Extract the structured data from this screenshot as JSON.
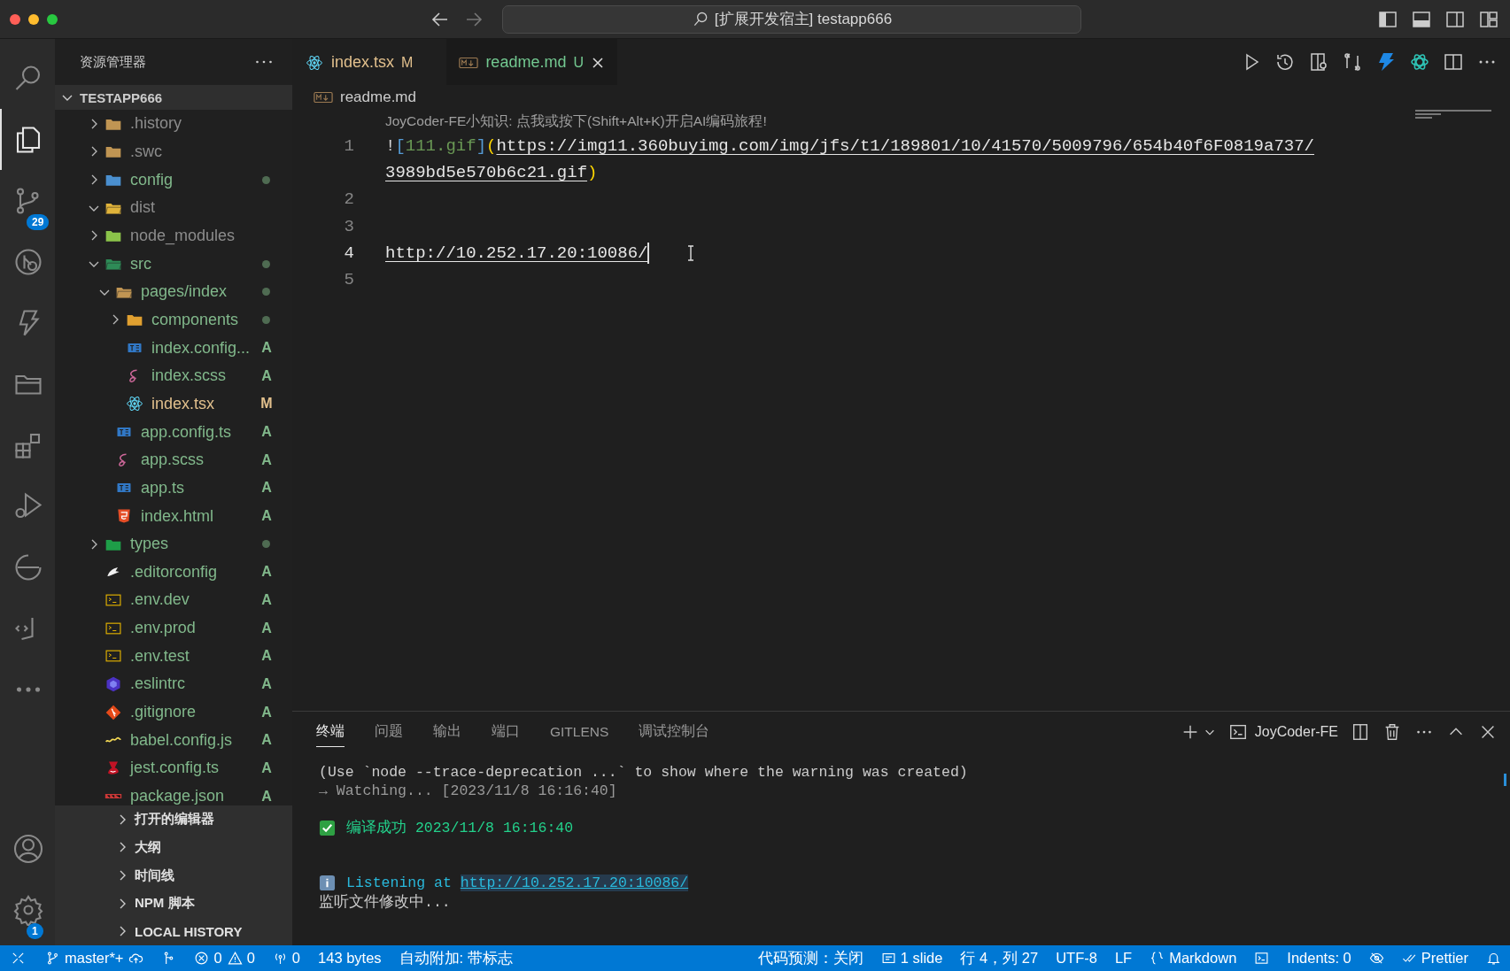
{
  "title_bar": {
    "search_text": "[扩展开发宿主] testapp666"
  },
  "activity_bar": {
    "top": [
      {
        "kind": "search",
        "selected": false
      },
      {
        "kind": "explorer",
        "selected": true
      },
      {
        "kind": "source-control",
        "selected": false,
        "badge": "29"
      },
      {
        "kind": "git-graph",
        "selected": false
      },
      {
        "kind": "joycoder",
        "selected": false
      },
      {
        "kind": "folders",
        "selected": false
      },
      {
        "kind": "extensions",
        "selected": false
      },
      {
        "kind": "run-debug",
        "selected": false
      },
      {
        "kind": "timeline",
        "selected": false
      },
      {
        "kind": "docker",
        "selected": false
      },
      {
        "kind": "more",
        "selected": false
      }
    ],
    "bottom": [
      {
        "kind": "account",
        "selected": false
      },
      {
        "kind": "settings",
        "selected": false,
        "badge": "1"
      }
    ]
  },
  "sidebar": {
    "title": "资源管理器",
    "project": "TESTAPP666",
    "expanded": true,
    "tree": [
      {
        "name": ".history",
        "kind": "folder",
        "ignored": true,
        "dot": false,
        "expanded": false
      },
      {
        "name": ".swc",
        "kind": "folder",
        "ignored": true,
        "dot": false,
        "expanded": false
      },
      {
        "name": "config",
        "kind": "config-folder",
        "ignored": false,
        "modified": false,
        "dot": true,
        "expanded": false
      },
      {
        "name": "dist",
        "kind": "dist-folder",
        "ignored": true,
        "dot": false,
        "expanded": true
      },
      {
        "name": "node_modules",
        "kind": "node-folder",
        "ignored": true,
        "dot": false,
        "expanded": false
      },
      {
        "name": "src",
        "kind": "src-folder",
        "ignored": false,
        "modified": false,
        "dot": true,
        "expanded": true,
        "children": [
          {
            "name": "pages/index",
            "kind": "folder",
            "ignored": false,
            "modified": false,
            "dot": true,
            "expanded": true,
            "children": [
              {
                "name": "components",
                "kind": "components-folder",
                "ignored": false,
                "modified": false,
                "dot": true,
                "expanded": false
              },
              {
                "name": "index.config...",
                "kind": "ts",
                "ignored": false,
                "modified": false,
                "badge": "A"
              },
              {
                "name": "index.scss",
                "kind": "scss",
                "ignored": false,
                "modified": false,
                "badge": "A"
              },
              {
                "name": "index.tsx",
                "kind": "react",
                "ignored": false,
                "modified": true,
                "badge": "M"
              }
            ]
          },
          {
            "name": "app.config.ts",
            "kind": "ts",
            "ignored": false,
            "modified": false,
            "badge": "A"
          },
          {
            "name": "app.scss",
            "kind": "scss",
            "ignored": false,
            "modified": false,
            "badge": "A"
          },
          {
            "name": "app.ts",
            "kind": "ts",
            "ignored": false,
            "modified": false,
            "badge": "A"
          },
          {
            "name": "index.html",
            "kind": "html",
            "ignored": false,
            "modified": false,
            "badge": "A"
          }
        ]
      },
      {
        "name": "types",
        "kind": "types-folder",
        "ignored": false,
        "modified": false,
        "dot": true,
        "expanded": false
      },
      {
        "name": ".editorconfig",
        "kind": "editorconfig",
        "ignored": false,
        "modified": false,
        "badge": "A"
      },
      {
        "name": ".env.dev",
        "kind": "env",
        "ignored": false,
        "modified": false,
        "badge": "A"
      },
      {
        "name": ".env.prod",
        "kind": "env",
        "ignored": false,
        "modified": false,
        "badge": "A"
      },
      {
        "name": ".env.test",
        "kind": "env",
        "ignored": false,
        "modified": false,
        "badge": "A"
      },
      {
        "name": ".eslintrc",
        "kind": "eslint",
        "ignored": false,
        "modified": false,
        "badge": "A"
      },
      {
        "name": ".gitignore",
        "kind": "git",
        "ignored": false,
        "modified": false,
        "badge": "A"
      },
      {
        "name": "babel.config.js",
        "kind": "babel",
        "ignored": false,
        "modified": false,
        "badge": "A"
      },
      {
        "name": "jest.config.ts",
        "kind": "jest",
        "ignored": false,
        "modified": false,
        "badge": "A"
      },
      {
        "name": "package.json",
        "kind": "npm",
        "ignored": false,
        "modified": false,
        "badge": "A"
      }
    ],
    "sections": [
      {
        "label": "打开的编辑器",
        "expanded": false
      },
      {
        "label": "大纲",
        "expanded": false
      },
      {
        "label": "时间线",
        "expanded": false
      },
      {
        "label": "NPM 脚本",
        "expanded": false
      },
      {
        "label": "LOCAL HISTORY",
        "expanded": false
      }
    ]
  },
  "tabs": [
    {
      "label": "index.tsx",
      "badge": "M",
      "kind": "react",
      "modified": true,
      "selected": false
    },
    {
      "label": "readme.md",
      "badge": "U",
      "kind": "markdown",
      "modified": false,
      "selected": true
    }
  ],
  "editor": {
    "breadcrumb": "readme.md",
    "codelens": "JoyCoder-FE小知识: 点我或按下(Shift+Alt+K)开启AI编码旅程!",
    "lines": [
      {
        "number": "1",
        "current": false,
        "tokens": [
          {
            "kind": "punct",
            "text": "!"
          },
          {
            "kind": "bracket",
            "text": "["
          },
          {
            "kind": "alt",
            "text": "111.gif"
          },
          {
            "kind": "bracket",
            "text": "]"
          },
          {
            "kind": "paren",
            "text": "("
          },
          {
            "kind": "link",
            "text": "https://img11.360buyimg.com/img/jfs/t1/189801/10/41570/5009796/654b40f6F0819a737/"
          },
          {
            "kind": "link",
            "text": "3989bd5e570b6c21.gif"
          },
          {
            "kind": "paren",
            "text": ")"
          }
        ]
      },
      {
        "number": "2",
        "current": false
      },
      {
        "number": "3",
        "current": false
      },
      {
        "number": "4",
        "current": true,
        "tokens": [
          {
            "kind": "link",
            "text": "http://10.252.17.20:10086/"
          }
        ]
      },
      {
        "number": "5",
        "current": false
      }
    ]
  },
  "panel": {
    "tabs": [
      {
        "label": "终端",
        "selected": true
      },
      {
        "label": "问题",
        "selected": false
      },
      {
        "label": "输出",
        "selected": false
      },
      {
        "label": "端口",
        "selected": false
      },
      {
        "label": "GITLENS",
        "selected": false
      },
      {
        "label": "调试控制台",
        "selected": false
      }
    ],
    "terminal_name": "JoyCoder-FE",
    "lines": [
      {
        "kind": "plain",
        "text": "(Use `node --trace-deprecation ...` to show where the warning was created)"
      },
      {
        "kind": "dim",
        "text": "→ Watching... [2023/11/8 16:16:40]"
      },
      {
        "kind": "blank"
      },
      {
        "kind": "success",
        "text": "编译成功 2023/11/8 16:16:40"
      },
      {
        "kind": "blank"
      },
      {
        "kind": "blank"
      },
      {
        "kind": "info",
        "text": "Listening at ",
        "link": "http://10.252.17.20:10086/"
      },
      {
        "kind": "plain",
        "text": "监听文件修改中..."
      }
    ]
  },
  "status_bar": {
    "left": [
      {
        "kind": "remote"
      },
      {
        "kind": "branch",
        "text": "master*+"
      },
      {
        "kind": "cloud"
      },
      {
        "kind": "graph"
      },
      {
        "kind": "error",
        "text": "0"
      },
      {
        "kind": "warning",
        "text": "0"
      },
      {
        "kind": "broadcast",
        "text": "0"
      },
      {
        "kind": "text",
        "text": "143 bytes"
      },
      {
        "kind": "text",
        "text": "自动附加: 带标志"
      }
    ],
    "right": [
      {
        "kind": "text",
        "text": "代码预测：关闭"
      },
      {
        "kind": "slides",
        "text": "1 slide"
      },
      {
        "kind": "text",
        "text": "行 4，列 27"
      },
      {
        "kind": "text",
        "text": "UTF-8"
      },
      {
        "kind": "text",
        "text": "LF"
      },
      {
        "kind": "braces",
        "text": "Markdown"
      },
      {
        "kind": "terminal"
      },
      {
        "kind": "text",
        "text": "Indents: 0"
      },
      {
        "kind": "eye-off"
      },
      {
        "kind": "check-all",
        "text": "Prettier"
      },
      {
        "kind": "bell"
      }
    ]
  }
}
